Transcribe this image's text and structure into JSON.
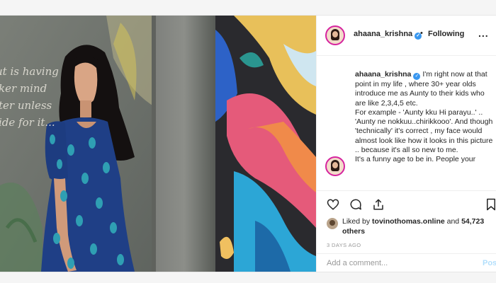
{
  "header": {
    "username": "ahaana_krishna",
    "verified_icon": "verified-badge-icon",
    "separator": "•",
    "follow_status": "Following",
    "more_icon": "..."
  },
  "caption": {
    "username": "ahaana_krishna",
    "text": "I'm right now at that point in my life , where 30+ year olds introduce me as Aunty to their kids who are like 2,3,4,5 etc.\nFor example - 'Aunty kku Hi parayu..' .. 'Aunty ne nokkuu..chirikkooo'. And though 'technically' it's correct , my face would almost look like how it looks in this picture .. because it's all so new to me.\nIt's a funny age to be in. People your"
  },
  "photo": {
    "wall_text": [
      "ut is having",
      "ker mind",
      "ter unless",
      "ide for it..."
    ]
  },
  "actions": {
    "like_icon": "heart-icon",
    "comment_icon": "comment-icon",
    "share_icon": "share-icon",
    "save_icon": "bookmark-icon"
  },
  "likes": {
    "prefix": "Liked by ",
    "user": "tovinothomas.online",
    "middle": " and ",
    "count": "54,723 others"
  },
  "date": "3 DAYS AGO",
  "comment": {
    "placeholder": "Add a comment...",
    "post_label": "Post"
  },
  "colors": {
    "accent": "#3897f0",
    "post_disabled": "#b2dffc",
    "muted": "#999999",
    "dress": "#1f3f86"
  }
}
